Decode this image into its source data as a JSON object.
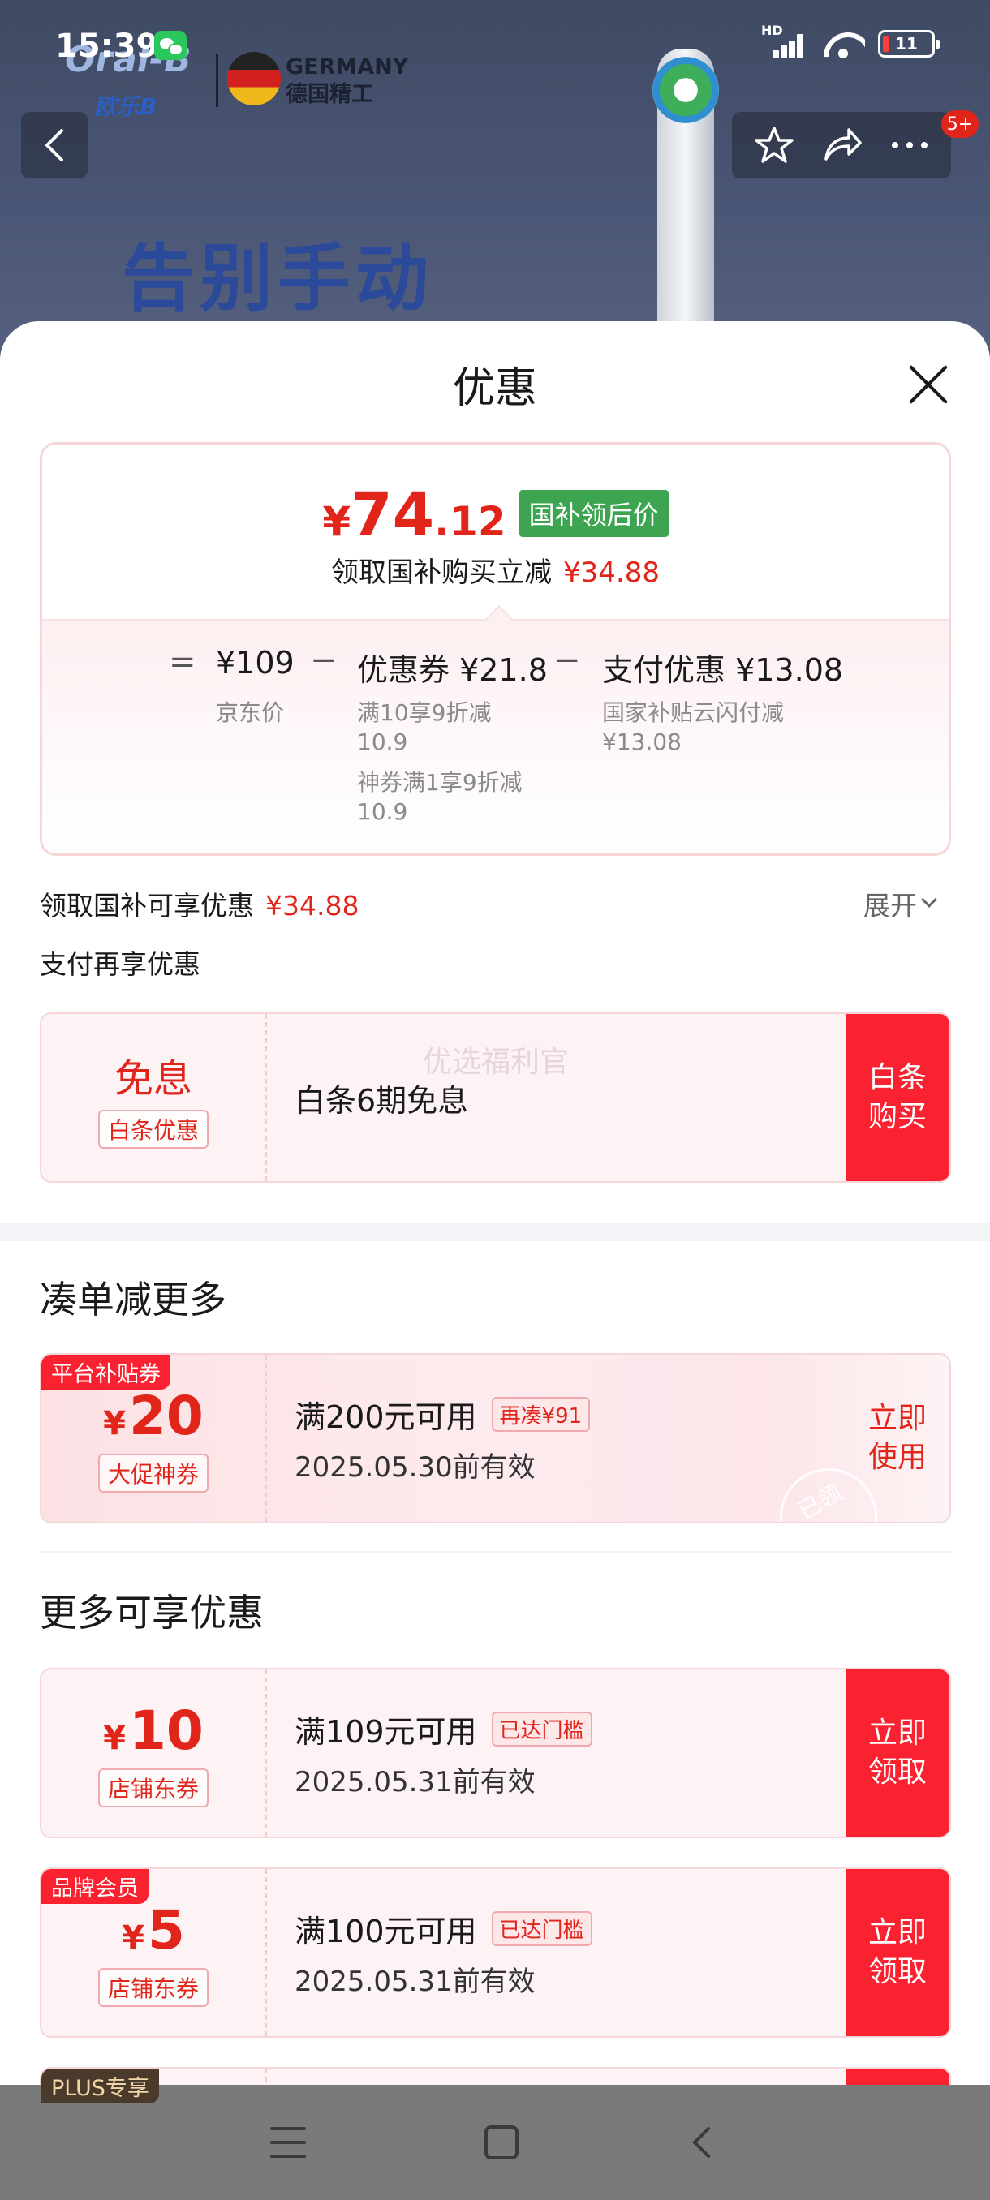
{
  "status_bar": {
    "time": "15:39",
    "network": "HD",
    "battery": "11"
  },
  "background_page": {
    "brand": "Oral-B",
    "brand_cn": "欧乐B",
    "country": "GERMANY",
    "country_cn": "德国精工",
    "hero": "告别手动",
    "badge_count": "5+"
  },
  "sheet": {
    "title": "优惠",
    "price_card": {
      "currency": "¥",
      "price_int": "74",
      "price_dec": ".12",
      "tag": "国补领后价",
      "subtitle": "领取国补购买立减",
      "subtitle_amount": "¥34.88",
      "calc": {
        "eq": "=",
        "base_price": "¥109",
        "base_label": "京东价",
        "minus1": "−",
        "coupon": "优惠券 ¥21.8",
        "coupon_detail1": "满10享9折减",
        "coupon_detail1b": "10.9",
        "coupon_detail2": "神券满1享9折减",
        "coupon_detail2b": "10.9",
        "minus2": "−",
        "pay": "支付优惠 ¥13.08",
        "pay_detail1": "国家补贴云闪付减",
        "pay_detail1b": "¥13.08"
      }
    },
    "guobu_row": {
      "label": "领取国补可享优惠",
      "amount": "¥34.88",
      "expand": "展开"
    },
    "pay_row_label": "支付再享优惠",
    "installment_card": {
      "big": "免息",
      "type": "白条优惠",
      "desc": "白条6期免息",
      "watermark": "优选福利官",
      "action_line1": "白条",
      "action_line2": "购买"
    },
    "section_more_order": "凑单减更多",
    "platform_coupon": {
      "corner": "平台补贴券",
      "currency": "¥",
      "value": "20",
      "type": "大促神券",
      "condition": "满200元可用",
      "tag": "再凑¥91",
      "date": "2025.05.30前有效",
      "action_line1": "立即",
      "action_line2": "使用",
      "stamp": "已领"
    },
    "section_more_offers": "更多可享优惠",
    "store_coupons": [
      {
        "corner": "",
        "currency": "¥",
        "value": "10",
        "type": "店铺东券",
        "condition": "满109元可用",
        "tag": "已达门槛",
        "date": "2025.05.31前有效",
        "action_line1": "立即",
        "action_line2": "领取"
      },
      {
        "corner": "品牌会员",
        "currency": "¥",
        "value": "5",
        "type": "店铺东券",
        "condition": "满100元可用",
        "tag": "已达门槛",
        "date": "2025.05.31前有效",
        "action_line1": "立即",
        "action_line2": "领取"
      }
    ],
    "partial_corner": "PLUS专享"
  },
  "colors": {
    "accent_red": "#e1251b",
    "button_red": "#fa2230",
    "green_tag": "#3da552"
  },
  "icons": [
    "back-arrow-icon",
    "star-icon",
    "share-icon",
    "more-icon",
    "close-icon",
    "chevron-down-icon",
    "menu-icon",
    "home-icon",
    "nav-back-icon"
  ]
}
